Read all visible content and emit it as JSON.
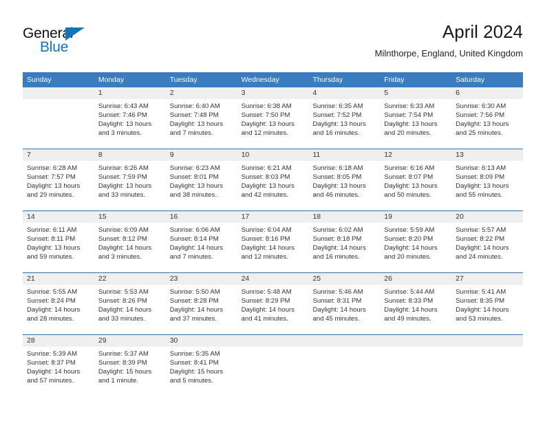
{
  "brand": {
    "name_part1": "General",
    "name_part2": "Blue",
    "accent_color": "#1272ba"
  },
  "header": {
    "title": "April 2024",
    "subtitle": "Milnthorpe, England, United Kingdom"
  },
  "theme": {
    "header_bar_color": "#3a7cbe",
    "date_band_color": "#efefef",
    "week_rule_color": "#2f6ea8"
  },
  "weekdays": [
    "Sunday",
    "Monday",
    "Tuesday",
    "Wednesday",
    "Thursday",
    "Friday",
    "Saturday"
  ],
  "labels": {
    "sunrise": "Sunrise:",
    "sunset": "Sunset:",
    "daylight": "Daylight:"
  },
  "weeks": [
    [
      {
        "day": "",
        "empty": true
      },
      {
        "day": "1",
        "sunrise": "Sunrise: 6:43 AM",
        "sunset": "Sunset: 7:46 PM",
        "daylight_line1": "Daylight: 13 hours",
        "daylight_line2": "and 3 minutes."
      },
      {
        "day": "2",
        "sunrise": "Sunrise: 6:40 AM",
        "sunset": "Sunset: 7:48 PM",
        "daylight_line1": "Daylight: 13 hours",
        "daylight_line2": "and 7 minutes."
      },
      {
        "day": "3",
        "sunrise": "Sunrise: 6:38 AM",
        "sunset": "Sunset: 7:50 PM",
        "daylight_line1": "Daylight: 13 hours",
        "daylight_line2": "and 12 minutes."
      },
      {
        "day": "4",
        "sunrise": "Sunrise: 6:35 AM",
        "sunset": "Sunset: 7:52 PM",
        "daylight_line1": "Daylight: 13 hours",
        "daylight_line2": "and 16 minutes."
      },
      {
        "day": "5",
        "sunrise": "Sunrise: 6:33 AM",
        "sunset": "Sunset: 7:54 PM",
        "daylight_line1": "Daylight: 13 hours",
        "daylight_line2": "and 20 minutes."
      },
      {
        "day": "6",
        "sunrise": "Sunrise: 6:30 AM",
        "sunset": "Sunset: 7:56 PM",
        "daylight_line1": "Daylight: 13 hours",
        "daylight_line2": "and 25 minutes."
      }
    ],
    [
      {
        "day": "7",
        "sunrise": "Sunrise: 6:28 AM",
        "sunset": "Sunset: 7:57 PM",
        "daylight_line1": "Daylight: 13 hours",
        "daylight_line2": "and 29 minutes."
      },
      {
        "day": "8",
        "sunrise": "Sunrise: 6:26 AM",
        "sunset": "Sunset: 7:59 PM",
        "daylight_line1": "Daylight: 13 hours",
        "daylight_line2": "and 33 minutes."
      },
      {
        "day": "9",
        "sunrise": "Sunrise: 6:23 AM",
        "sunset": "Sunset: 8:01 PM",
        "daylight_line1": "Daylight: 13 hours",
        "daylight_line2": "and 38 minutes."
      },
      {
        "day": "10",
        "sunrise": "Sunrise: 6:21 AM",
        "sunset": "Sunset: 8:03 PM",
        "daylight_line1": "Daylight: 13 hours",
        "daylight_line2": "and 42 minutes."
      },
      {
        "day": "11",
        "sunrise": "Sunrise: 6:18 AM",
        "sunset": "Sunset: 8:05 PM",
        "daylight_line1": "Daylight: 13 hours",
        "daylight_line2": "and 46 minutes."
      },
      {
        "day": "12",
        "sunrise": "Sunrise: 6:16 AM",
        "sunset": "Sunset: 8:07 PM",
        "daylight_line1": "Daylight: 13 hours",
        "daylight_line2": "and 50 minutes."
      },
      {
        "day": "13",
        "sunrise": "Sunrise: 6:13 AM",
        "sunset": "Sunset: 8:09 PM",
        "daylight_line1": "Daylight: 13 hours",
        "daylight_line2": "and 55 minutes."
      }
    ],
    [
      {
        "day": "14",
        "sunrise": "Sunrise: 6:11 AM",
        "sunset": "Sunset: 8:11 PM",
        "daylight_line1": "Daylight: 13 hours",
        "daylight_line2": "and 59 minutes."
      },
      {
        "day": "15",
        "sunrise": "Sunrise: 6:09 AM",
        "sunset": "Sunset: 8:12 PM",
        "daylight_line1": "Daylight: 14 hours",
        "daylight_line2": "and 3 minutes."
      },
      {
        "day": "16",
        "sunrise": "Sunrise: 6:06 AM",
        "sunset": "Sunset: 8:14 PM",
        "daylight_line1": "Daylight: 14 hours",
        "daylight_line2": "and 7 minutes."
      },
      {
        "day": "17",
        "sunrise": "Sunrise: 6:04 AM",
        "sunset": "Sunset: 8:16 PM",
        "daylight_line1": "Daylight: 14 hours",
        "daylight_line2": "and 12 minutes."
      },
      {
        "day": "18",
        "sunrise": "Sunrise: 6:02 AM",
        "sunset": "Sunset: 8:18 PM",
        "daylight_line1": "Daylight: 14 hours",
        "daylight_line2": "and 16 minutes."
      },
      {
        "day": "19",
        "sunrise": "Sunrise: 5:59 AM",
        "sunset": "Sunset: 8:20 PM",
        "daylight_line1": "Daylight: 14 hours",
        "daylight_line2": "and 20 minutes."
      },
      {
        "day": "20",
        "sunrise": "Sunrise: 5:57 AM",
        "sunset": "Sunset: 8:22 PM",
        "daylight_line1": "Daylight: 14 hours",
        "daylight_line2": "and 24 minutes."
      }
    ],
    [
      {
        "day": "21",
        "sunrise": "Sunrise: 5:55 AM",
        "sunset": "Sunset: 8:24 PM",
        "daylight_line1": "Daylight: 14 hours",
        "daylight_line2": "and 28 minutes."
      },
      {
        "day": "22",
        "sunrise": "Sunrise: 5:53 AM",
        "sunset": "Sunset: 8:26 PM",
        "daylight_line1": "Daylight: 14 hours",
        "daylight_line2": "and 33 minutes."
      },
      {
        "day": "23",
        "sunrise": "Sunrise: 5:50 AM",
        "sunset": "Sunset: 8:28 PM",
        "daylight_line1": "Daylight: 14 hours",
        "daylight_line2": "and 37 minutes."
      },
      {
        "day": "24",
        "sunrise": "Sunrise: 5:48 AM",
        "sunset": "Sunset: 8:29 PM",
        "daylight_line1": "Daylight: 14 hours",
        "daylight_line2": "and 41 minutes."
      },
      {
        "day": "25",
        "sunrise": "Sunrise: 5:46 AM",
        "sunset": "Sunset: 8:31 PM",
        "daylight_line1": "Daylight: 14 hours",
        "daylight_line2": "and 45 minutes."
      },
      {
        "day": "26",
        "sunrise": "Sunrise: 5:44 AM",
        "sunset": "Sunset: 8:33 PM",
        "daylight_line1": "Daylight: 14 hours",
        "daylight_line2": "and 49 minutes."
      },
      {
        "day": "27",
        "sunrise": "Sunrise: 5:41 AM",
        "sunset": "Sunset: 8:35 PM",
        "daylight_line1": "Daylight: 14 hours",
        "daylight_line2": "and 53 minutes."
      }
    ],
    [
      {
        "day": "28",
        "sunrise": "Sunrise: 5:39 AM",
        "sunset": "Sunset: 8:37 PM",
        "daylight_line1": "Daylight: 14 hours",
        "daylight_line2": "and 57 minutes."
      },
      {
        "day": "29",
        "sunrise": "Sunrise: 5:37 AM",
        "sunset": "Sunset: 8:39 PM",
        "daylight_line1": "Daylight: 15 hours",
        "daylight_line2": "and 1 minute."
      },
      {
        "day": "30",
        "sunrise": "Sunrise: 5:35 AM",
        "sunset": "Sunset: 8:41 PM",
        "daylight_line1": "Daylight: 15 hours",
        "daylight_line2": "and 5 minutes."
      },
      {
        "day": "",
        "empty": true
      },
      {
        "day": "",
        "empty": true
      },
      {
        "day": "",
        "empty": true
      },
      {
        "day": "",
        "empty": true
      }
    ]
  ]
}
